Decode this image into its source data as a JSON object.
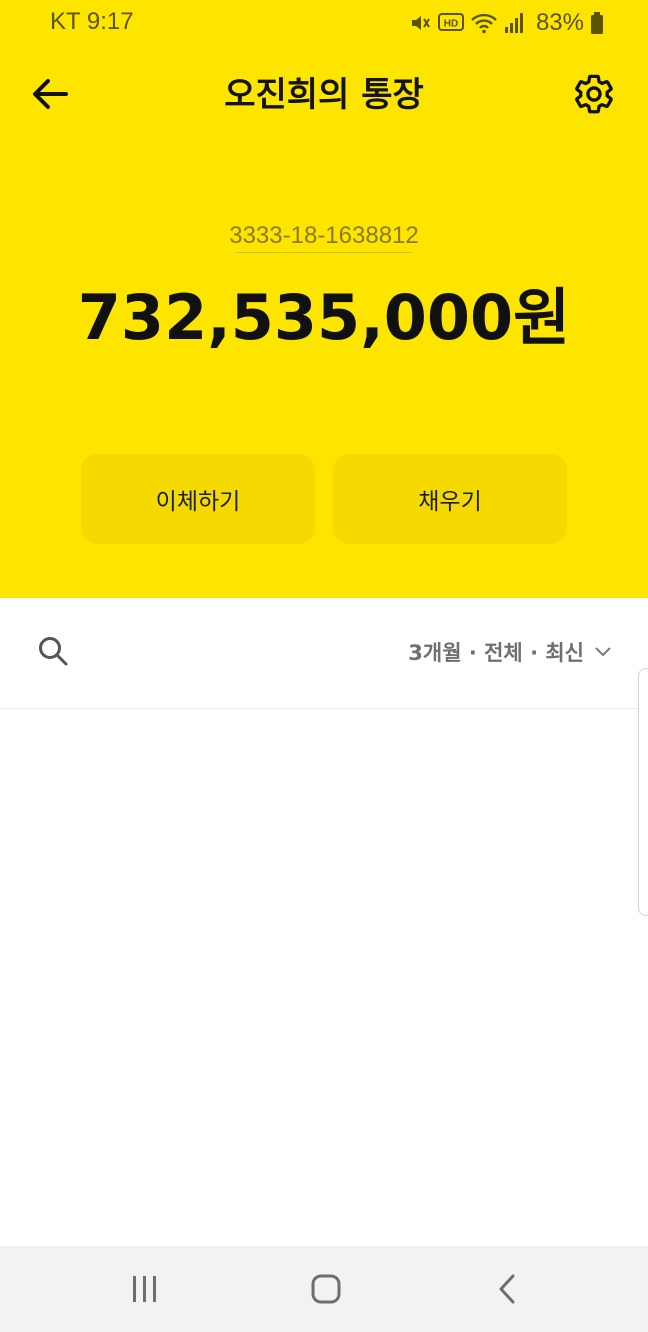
{
  "status_bar": {
    "carrier_time": "KT 9:17",
    "battery": "83%",
    "icons": [
      "mute-icon",
      "hd-icon",
      "wifi-icon",
      "signal-icon",
      "battery-icon"
    ]
  },
  "header": {
    "title": "오진희의 통장",
    "back_icon": "arrow-left-icon",
    "settings_icon": "gear-icon",
    "background_color": "#FEE500"
  },
  "account": {
    "number": "3333-18-1638812",
    "balance": "732,535,000원"
  },
  "actions": {
    "transfer_label": "이체하기",
    "fill_label": "채우기"
  },
  "toolbar": {
    "search_icon": "search-icon",
    "filter_label": "3개월 · 전체 · 최신",
    "filter_icon": "chevron-down-icon"
  },
  "navigation_bar": {
    "items": [
      "recents-icon",
      "home-icon",
      "back-icon"
    ]
  }
}
